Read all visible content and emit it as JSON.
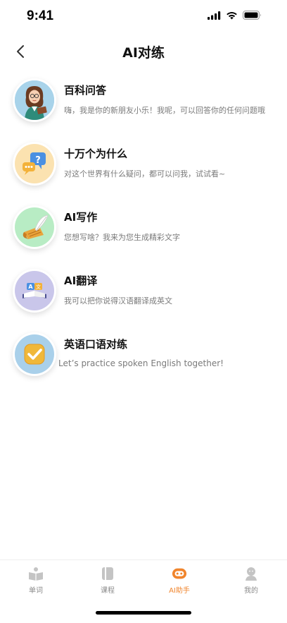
{
  "status": {
    "time": "9:41"
  },
  "nav": {
    "title": "AI对练"
  },
  "items": [
    {
      "title": "百科问答",
      "desc": "嗨，我是你的新朋友小乐！我呢，可以回答你的任何问题哦"
    },
    {
      "title": "十万个为什么",
      "desc": "对这个世界有什么疑问，都可以问我，试试看~"
    },
    {
      "title": "AI写作",
      "desc": "您想写啥？我来为您生成精彩文字"
    },
    {
      "title": "AI翻译",
      "desc": "我可以把你说得汉语翻译成英文"
    },
    {
      "title": "英语口语对练",
      "desc": "Let’s practice spoken English together!"
    }
  ],
  "tabs": [
    {
      "label": "单词",
      "icon": "book-icon",
      "active": false
    },
    {
      "label": "课程",
      "icon": "notebook-icon",
      "active": false
    },
    {
      "label": "AI助手",
      "icon": "robot-icon",
      "active": true
    },
    {
      "label": "我的",
      "icon": "profile-icon",
      "active": false
    }
  ],
  "colors": {
    "accent": "#f0852d",
    "inactive": "#bdbdbd"
  }
}
